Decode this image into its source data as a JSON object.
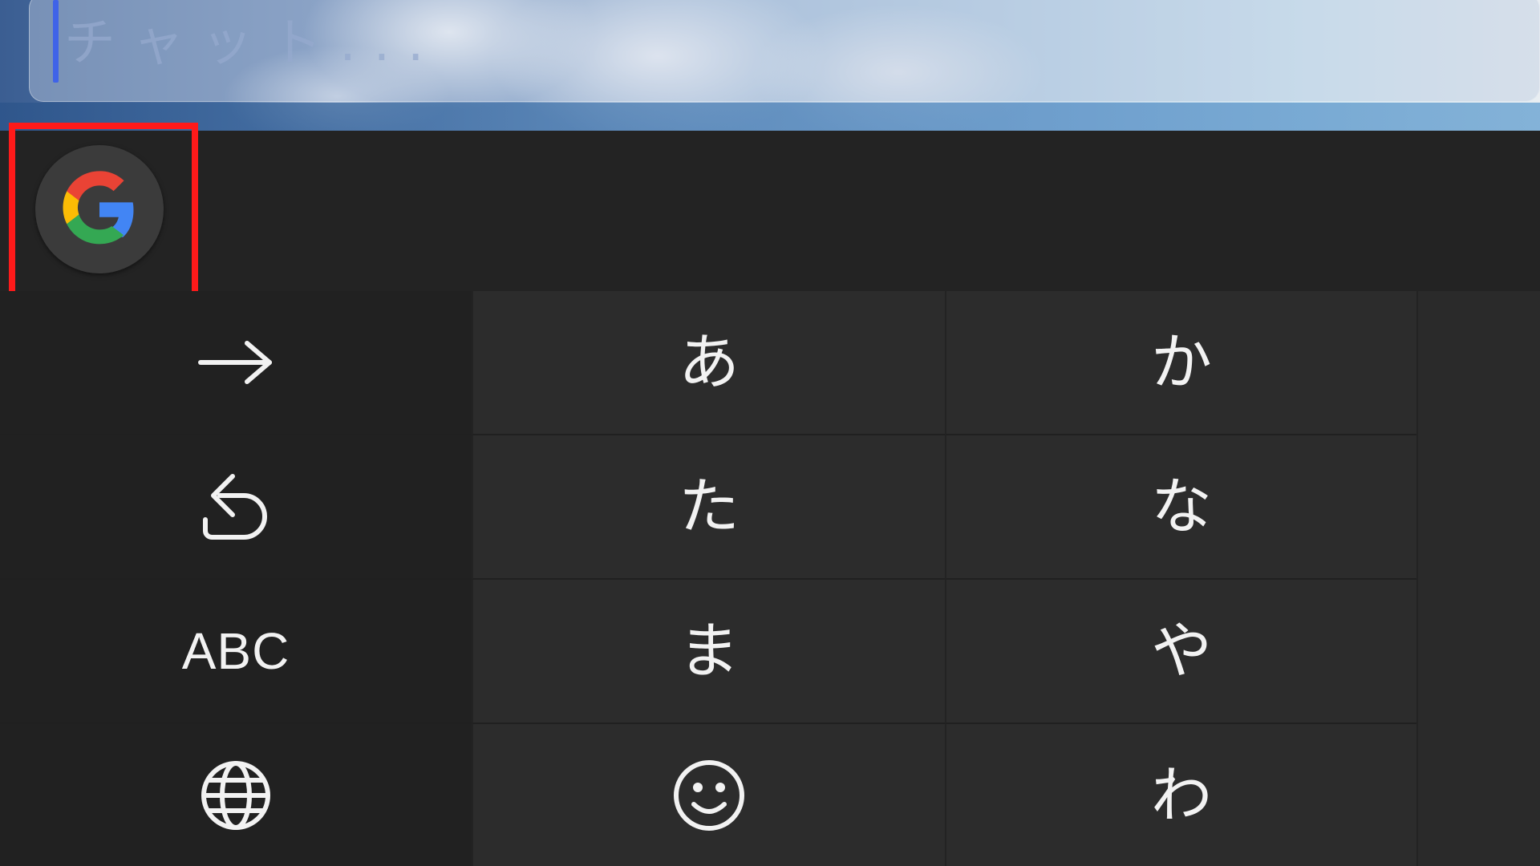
{
  "chat": {
    "placeholder": "チャット..."
  },
  "toolbar": {
    "google_button_icon": "google-g-icon"
  },
  "keys": {
    "next": {
      "icon": "arrow-right-icon"
    },
    "undo": {
      "icon": "undo-icon"
    },
    "abc": {
      "label": "ABC"
    },
    "globe": {
      "icon": "globe-icon"
    },
    "a": {
      "label": "あ"
    },
    "ta": {
      "label": "た"
    },
    "ma": {
      "label": "ま"
    },
    "emoji": {
      "icon": "emoji-icon"
    },
    "ka": {
      "label": "か"
    },
    "na": {
      "label": "な"
    },
    "ya": {
      "label": "や"
    },
    "wa": {
      "label": "わ"
    }
  },
  "colors": {
    "highlight": "#ff1a1a",
    "caret": "#3f63e8",
    "google_blue": "#4285F4",
    "google_red": "#EA4335",
    "google_yellow": "#FBBC05",
    "google_green": "#34A853"
  }
}
